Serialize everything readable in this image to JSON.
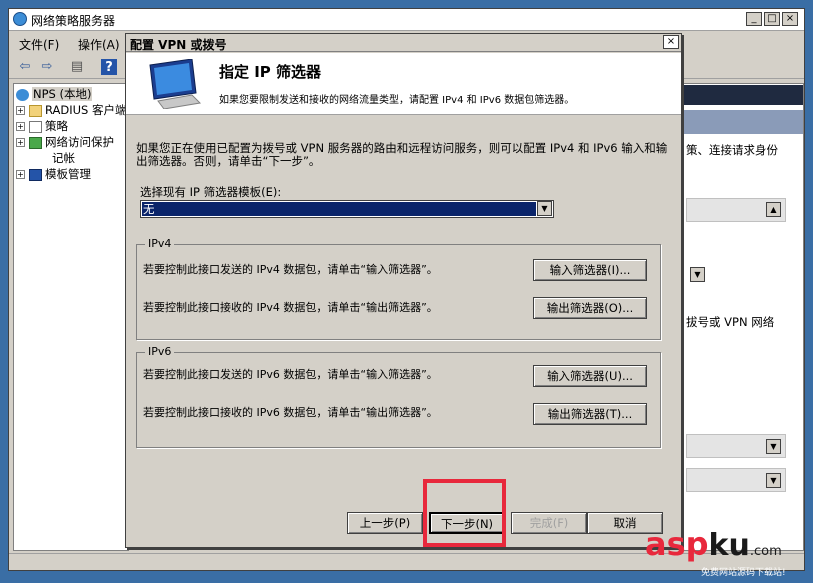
{
  "main_window": {
    "title": "网络策略服务器",
    "menu": [
      "文件(F)",
      "操作(A)"
    ],
    "tree": {
      "root": "NPS (本地)",
      "items": [
        "RADIUS 客户端",
        "策略",
        "网络访问保护",
        "记帐",
        "模板管理"
      ]
    },
    "right_pane": {
      "text1": "策、连接请求身份",
      "text2": "拔号或 VPN 网络"
    }
  },
  "dialog": {
    "title": "配置 VPN 或拨号",
    "header_title": "指定 IP 筛选器",
    "header_desc": "如果您要限制发送和接收的网络流量类型，请配置 IPv4 和 IPv6 数据包筛选器。",
    "intro": "如果您正在使用已配置为拨号或 VPN 服务器的路由和远程访问服务，则可以配置 IPv4 和 IPv6 输入和输出筛选器。否则，请单击“下一步”。",
    "template_label": "选择现有 IP 筛选器模板(E):",
    "template_value": "无",
    "ipv4": {
      "legend": "IPv4",
      "input_text": "若要控制此接口发送的 IPv4 数据包，请单击“输入筛选器”。",
      "input_button": "输入筛选器(I)...",
      "output_text": "若要控制此接口接收的 IPv4 数据包，请单击“输出筛选器”。",
      "output_button": "输出筛选器(O)..."
    },
    "ipv6": {
      "legend": "IPv6",
      "input_text": "若要控制此接口发送的 IPv6 数据包，请单击“输入筛选器”。",
      "input_button": "输入筛选器(U)...",
      "output_text": "若要控制此接口接收的 IPv6 数据包，请单击“输出筛选器”。",
      "output_button": "输出筛选器(T)..."
    },
    "buttons": {
      "back": "上一步(P)",
      "next": "下一步(N)",
      "finish": "完成(F)",
      "cancel": "取消"
    }
  },
  "watermark": {
    "brand_red": "asp",
    "brand_dark": "ku",
    "suffix": ".com",
    "tagline": "免费网站源码下载站!"
  },
  "colors": {
    "desktop": "#3a6ea5",
    "highlight": "#0a246a",
    "annotation_red": "#e8283c"
  }
}
